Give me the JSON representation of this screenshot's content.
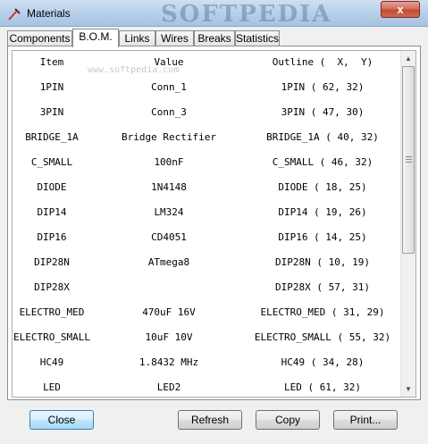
{
  "window": {
    "title": "Materials",
    "watermark": "SOFTPEDIA",
    "close_glyph": "x"
  },
  "tabs": [
    {
      "label": "Components"
    },
    {
      "label": "B.O.M.",
      "active": true
    },
    {
      "label": "Links"
    },
    {
      "label": "Wires"
    },
    {
      "label": "Breaks"
    },
    {
      "label": "Statistics"
    }
  ],
  "bom": {
    "header": [
      "Item",
      "Value",
      "Outline (  X,  Y)"
    ],
    "site_watermark": "www.softpedia.com",
    "rows": [
      [
        "1PIN",
        "Conn_1",
        "1PIN ( 62, 32)"
      ],
      [
        "3PIN",
        "Conn_3",
        "3PIN ( 47, 30)"
      ],
      [
        "BRIDGE_1A",
        "Bridge Rectifier",
        "BRIDGE_1A ( 40, 32)"
      ],
      [
        "C_SMALL",
        "100nF",
        "C_SMALL ( 46, 32)"
      ],
      [
        "DIODE",
        "1N4148",
        "DIODE ( 18, 25)"
      ],
      [
        "DIP14",
        "LM324",
        "DIP14 ( 19, 26)"
      ],
      [
        "DIP16",
        "CD4051",
        "DIP16 ( 14, 25)"
      ],
      [
        "DIP28N",
        "ATmega8",
        "DIP28N ( 10, 19)"
      ],
      [
        "DIP28X",
        "",
        "DIP28X ( 57, 31)"
      ],
      [
        "ELECTRO_MED",
        "470uF 16V",
        "ELECTRO_MED ( 31, 29)"
      ],
      [
        "ELECTRO_SMALL",
        "10uF 10V",
        "ELECTRO_SMALL ( 55, 32)"
      ],
      [
        "HC49",
        "1.8432 MHz",
        "HC49 ( 34, 28)"
      ],
      [
        "LED",
        "LED2",
        "LED ( 61, 32)"
      ]
    ]
  },
  "buttons": {
    "close": "Close",
    "refresh": "Refresh",
    "copy": "Copy",
    "print": "Print..."
  }
}
